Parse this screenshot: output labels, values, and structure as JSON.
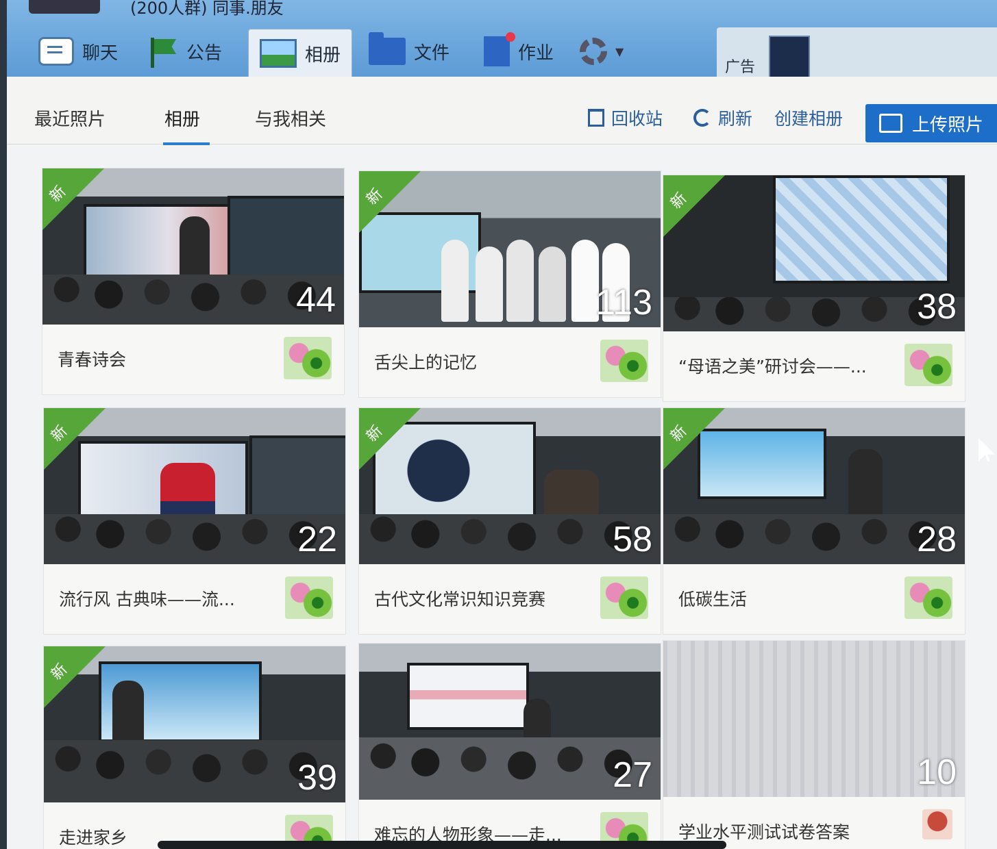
{
  "window_title": "(200人群) 同事.朋友",
  "toolbar": {
    "items": [
      {
        "label": "聊天",
        "icon": "chat-icon"
      },
      {
        "label": "公告",
        "icon": "flag-icon"
      },
      {
        "label": "相册",
        "icon": "album-icon"
      },
      {
        "label": "文件",
        "icon": "folder-icon"
      },
      {
        "label": "作业",
        "icon": "homework-icon"
      }
    ],
    "ad_label": "广告"
  },
  "tabs": [
    {
      "label": "最近照片"
    },
    {
      "label": "相册"
    },
    {
      "label": "与我相关"
    }
  ],
  "actions": {
    "recycle": "回收站",
    "refresh": "刷新",
    "create_album": "创建相册",
    "upload": "上传照片"
  },
  "albums": [
    {
      "title": "青春诗会",
      "count": "44",
      "is_new": true,
      "badge": "新"
    },
    {
      "title": "舌尖上的记忆",
      "count": "113",
      "is_new": true,
      "badge": "新"
    },
    {
      "title": "“母语之美”研讨会——...",
      "count": "38",
      "is_new": true,
      "badge": "新"
    },
    {
      "title": "流行风 古典味——流...",
      "count": "22",
      "is_new": true,
      "badge": "新"
    },
    {
      "title": "古代文化常识知识竞赛",
      "count": "58",
      "is_new": true,
      "badge": "新"
    },
    {
      "title": "低碳生活",
      "count": "28",
      "is_new": true,
      "badge": "新"
    },
    {
      "title": "走进家乡",
      "count": "39",
      "is_new": true,
      "badge": "新"
    },
    {
      "title": "难忘的人物形象——走...",
      "count": "27",
      "is_new": false,
      "badge": ""
    },
    {
      "title": "学业水平测试试卷答案",
      "count": "10",
      "is_new": false,
      "badge": ""
    }
  ],
  "colors": {
    "toolbar_blue": "#6aa5db",
    "accent_blue": "#1d6ec9",
    "new_badge_green": "#57a63a"
  }
}
